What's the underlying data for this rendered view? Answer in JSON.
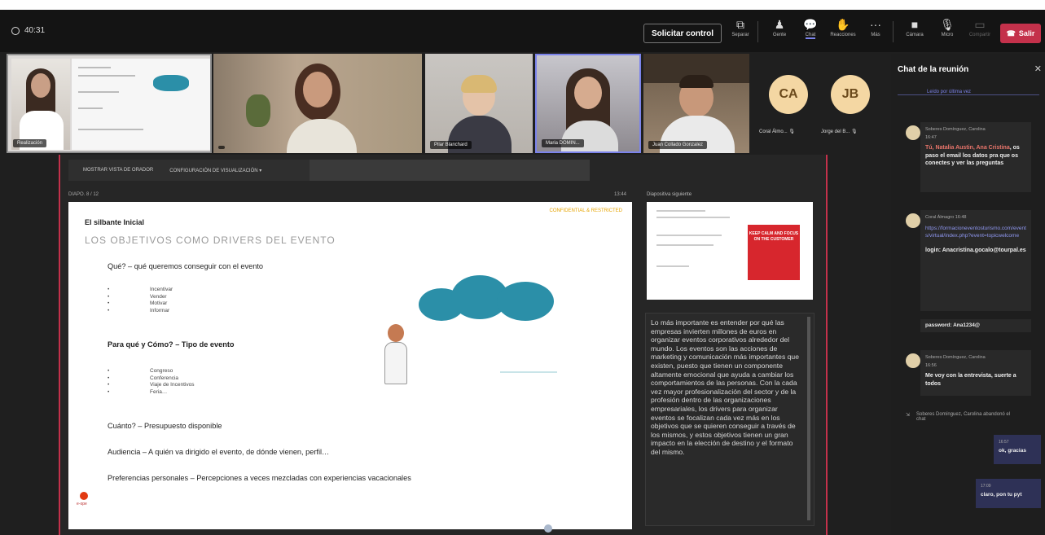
{
  "window": {
    "timer": "40:31"
  },
  "toolbar": {
    "request_control": "Solicitar control",
    "items": [
      {
        "label": "Separar",
        "icon": "pop-out-icon"
      },
      {
        "label": "Gente",
        "icon": "people-icon"
      },
      {
        "label": "Chat",
        "icon": "chat-icon"
      },
      {
        "label": "Reacciones",
        "icon": "reactions-icon"
      },
      {
        "label": "Más",
        "icon": "more-icon"
      },
      {
        "label": "Cámara",
        "icon": "camera-icon"
      },
      {
        "label": "Micro",
        "icon": "mic-icon"
      },
      {
        "label": "Compartir",
        "icon": "share-icon"
      }
    ],
    "leave": "Salir"
  },
  "participants": {
    "tiles": [
      {
        "name": "Realización"
      },
      {
        "name": ""
      },
      {
        "name": "Pilar Blanchard"
      },
      {
        "name": "Maria DOMIN..."
      },
      {
        "name": "Juan Collado Gonzalez"
      }
    ],
    "avatars": [
      {
        "initials": "CA",
        "name": "Coral Álmo..."
      },
      {
        "initials": "JB",
        "name": "Jorge del B..."
      }
    ]
  },
  "presenter": {
    "tool1": "MOSTRAR VISTA DE ORADOR",
    "tool2": "CONFIGURACIÓN DE VISUALIZACIÓN ▾",
    "slide_counter": "DIAPO. 8 / 12",
    "elapsed": "13:44",
    "next_label": "Diapositiva siguiente",
    "next_slide": {
      "keep": "KEEP CALM AND FOCUS ON THE CUSTOMER"
    },
    "notes": "Lo más importante es entender por qué las empresas invierten millones de euros en organizar eventos corporativos alrededor del mundo. Los eventos son las acciones de marketing y comunicación más importantes que existen, puesto que tienen un componente altamente emocional que ayuda a cambiar los comportamientos de las personas. Con la cada vez mayor profesionalización del sector y de la profesión dentro de las organizaciones empresariales, los drivers para organizar eventos se focalizan cada vez más en los objetivos que se quieren conseguir a través de los mismos, y estos objetivos tienen un gran impacto en la elección de destino y el formato del mismo."
  },
  "slide": {
    "kicker": "El silbante Inicial",
    "confidential": "CONFIDENTIAL & RESTRICTED",
    "title": "LOS OBJETIVOS COMO DRIVERS DEL EVENTO",
    "q1": "Qué? – qué queremos conseguir con el evento",
    "list1": [
      "Incentivar",
      "Vender",
      "Motivar",
      "Informar"
    ],
    "q2": "Para qué y Cómo? – Tipo de evento",
    "list2": [
      "Congreso",
      "Conferencia",
      "Viaje de Incentivos",
      "Feria…"
    ],
    "q3": "Cuánto? – Presupuesto disponible",
    "q4": "Audiencia – A quién va dirigido el evento, de dónde vienen, perfil…",
    "q5": "Preferencias personales – Percepciones a veces mezcladas con experiencias vacacionales",
    "logo": "e-ope"
  },
  "chat": {
    "title": "Chat de la reunión",
    "history_link": "Leído por última vez",
    "messages": [
      {
        "author": "Soberes Domínguez, Carolina",
        "time": "16:47",
        "mention": "Tú, Natalia Austin, Ana Cristina",
        "text": ", os paso el email los datos pra que os conectes y ver las preguntas"
      },
      {
        "author": "Coral Álmagro",
        "time": "16:48",
        "link": "https://formacioneventosturismo.com/events/virtual/index.php?event=topicwelcome",
        "login": "login: Anacristina.gocalo@tourpal.es"
      },
      {
        "password": "password: Ana1234@"
      },
      {
        "author": "Soberes Domínguez, Carolina",
        "time": "16:56",
        "text": "Me voy con la entrevista, suerte a todos"
      }
    ],
    "left_note": "Soberes Domínguez, Carolina abandonó el chat",
    "mine": [
      {
        "time": "16:57",
        "text": "ok, gracias"
      },
      {
        "time": "17:09",
        "text": "claro, pon tu pyt"
      }
    ]
  }
}
